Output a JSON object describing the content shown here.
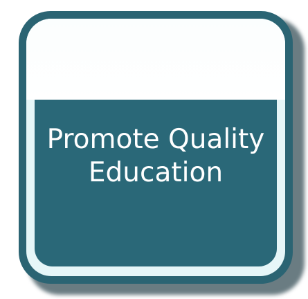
{
  "tile": {
    "title_line_1": "Promote Quality",
    "title_line_2": "Education"
  },
  "colors": {
    "tile_dark": "#2b6473",
    "panel_teal": "#2a6878",
    "frame_light": "#e6f6f8",
    "text": "#ffffff"
  }
}
